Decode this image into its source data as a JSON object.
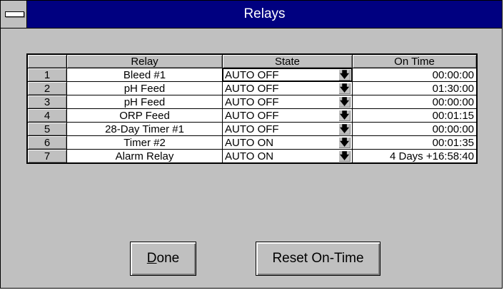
{
  "window": {
    "title": "Relays"
  },
  "table": {
    "headers": {
      "corner": "",
      "relay": "Relay",
      "state": "State",
      "on_time": "On Time"
    },
    "rows": [
      {
        "num": "1",
        "relay": "Bleed #1",
        "state": "AUTO OFF",
        "on_time": "00:00:00"
      },
      {
        "num": "2",
        "relay": "pH Feed",
        "state": "AUTO OFF",
        "on_time": "01:30:00"
      },
      {
        "num": "3",
        "relay": "pH Feed",
        "state": "AUTO OFF",
        "on_time": "00:00:00"
      },
      {
        "num": "4",
        "relay": "ORP Feed",
        "state": "AUTO OFF",
        "on_time": "00:01:15"
      },
      {
        "num": "5",
        "relay": "28-Day Timer #1",
        "state": "AUTO OFF",
        "on_time": "00:00:00"
      },
      {
        "num": "6",
        "relay": "Timer #2",
        "state": "AUTO ON",
        "on_time": "00:01:35"
      },
      {
        "num": "7",
        "relay": "Alarm Relay",
        "state": "AUTO ON",
        "on_time": "4 Days +16:58:40"
      }
    ],
    "dropdown_icon": "down-arrow-icon"
  },
  "buttons": {
    "done_mnemonic": "D",
    "done_rest": "one",
    "reset_label": "Reset On-Time"
  }
}
